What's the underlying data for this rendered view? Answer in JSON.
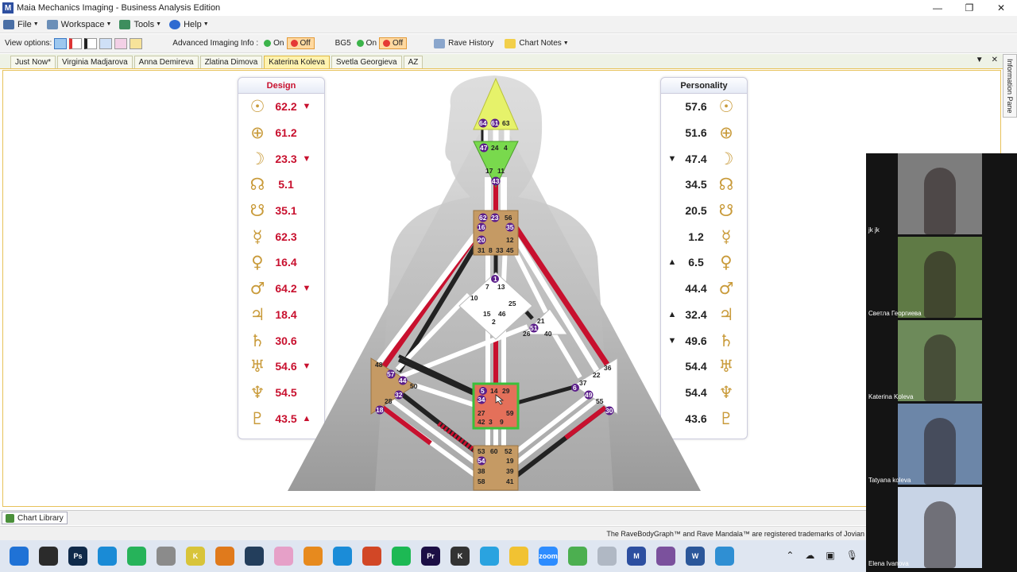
{
  "window": {
    "title": "Maia Mechanics Imaging - Business Analysis Edition"
  },
  "menu": [
    {
      "label": "File",
      "color": "#4a6fa5"
    },
    {
      "label": "Workspace",
      "color": "#6b8fb8"
    },
    {
      "label": "Tools",
      "color": "#3e8e5e"
    },
    {
      "label": "Help",
      "color": "#2f6bd1"
    }
  ],
  "toolbar": {
    "view_options_label": "View options:",
    "advanced_label": "Advanced Imaging Info :",
    "bg5_label": "BG5",
    "on_label": "On",
    "off_label": "Off",
    "rave_history": "Rave History",
    "chart_notes": "Chart Notes"
  },
  "tabs": [
    {
      "label": "Just Now*",
      "active": false
    },
    {
      "label": "Virginia Madjarova",
      "active": false
    },
    {
      "label": "Anna Demireva",
      "active": false
    },
    {
      "label": "Zlatina Dimova",
      "active": false
    },
    {
      "label": "Katerina Koleva",
      "active": true
    },
    {
      "label": "Svetla Georgieva",
      "active": false
    },
    {
      "label": "AZ",
      "active": false
    }
  ],
  "info_pane_label": "Information Pane",
  "design": {
    "title": "Design",
    "rows": [
      {
        "glyph": "☉",
        "value": "62.2",
        "arrow": "▼"
      },
      {
        "glyph": "⊕",
        "value": "61.2",
        "arrow": ""
      },
      {
        "glyph": "☽",
        "value": "23.3",
        "arrow": "▼"
      },
      {
        "glyph": "☊",
        "value": "5.1",
        "arrow": ""
      },
      {
        "glyph": "☋",
        "value": "35.1",
        "arrow": ""
      },
      {
        "glyph": "☿",
        "value": "62.3",
        "arrow": ""
      },
      {
        "glyph": "♀",
        "value": "16.4",
        "arrow": ""
      },
      {
        "glyph": "♂",
        "value": "64.2",
        "arrow": "▼"
      },
      {
        "glyph": "♃",
        "value": "18.4",
        "arrow": ""
      },
      {
        "glyph": "♄",
        "value": "30.6",
        "arrow": ""
      },
      {
        "glyph": "♅",
        "value": "54.6",
        "arrow": "▼"
      },
      {
        "glyph": "♆",
        "value": "54.5",
        "arrow": ""
      },
      {
        "glyph": "♇",
        "value": "43.5",
        "arrow": "▲"
      }
    ]
  },
  "personality": {
    "title": "Personality",
    "rows": [
      {
        "glyph": "☉",
        "value": "57.6",
        "arrow": ""
      },
      {
        "glyph": "⊕",
        "value": "51.6",
        "arrow": ""
      },
      {
        "glyph": "☽",
        "value": "47.4",
        "arrow": "▼"
      },
      {
        "glyph": "☊",
        "value": "34.5",
        "arrow": ""
      },
      {
        "glyph": "☋",
        "value": "20.5",
        "arrow": ""
      },
      {
        "glyph": "☿",
        "value": "1.2",
        "arrow": ""
      },
      {
        "glyph": "♀",
        "value": "6.5",
        "arrow": "▲"
      },
      {
        "glyph": "♂",
        "value": "44.4",
        "arrow": ""
      },
      {
        "glyph": "♃",
        "value": "32.4",
        "arrow": "▲"
      },
      {
        "glyph": "♄",
        "value": "49.6",
        "arrow": "▼"
      },
      {
        "glyph": "♅",
        "value": "54.4",
        "arrow": ""
      },
      {
        "glyph": "♆",
        "value": "54.4",
        "arrow": ""
      },
      {
        "glyph": "♇",
        "value": "43.6",
        "arrow": ""
      }
    ]
  },
  "bodygraph": {
    "head_gates": [
      "64",
      "61",
      "63"
    ],
    "ajna_gates": [
      "47",
      "24",
      "4",
      "17",
      "11",
      "43"
    ],
    "throat_gates": [
      "62",
      "23",
      "56",
      "16",
      "35",
      "20",
      "12",
      "31",
      "8",
      "33",
      "45"
    ],
    "g_gates": [
      "1",
      "7",
      "13",
      "10",
      "25",
      "15",
      "46",
      "2"
    ],
    "ego_gates": [
      "21",
      "51",
      "26",
      "40"
    ],
    "spleen_gates": [
      "48",
      "57",
      "44",
      "50",
      "32",
      "28",
      "18"
    ],
    "sacral_gates": [
      "5",
      "14",
      "29",
      "34",
      "27",
      "59",
      "42",
      "3",
      "9"
    ],
    "solar_gates": [
      "36",
      "22",
      "37",
      "6",
      "49",
      "55",
      "30"
    ],
    "root_gates": [
      "53",
      "60",
      "52",
      "54",
      "19",
      "38",
      "39",
      "58",
      "41"
    ]
  },
  "chart_library": "Chart Library",
  "trademark": "The RaveBodyGraph™ and Rave Mandala™ are registered trademarks of Jovian",
  "participants": [
    {
      "name": "jk jk",
      "bg": "#7d7d7d"
    },
    {
      "name": "Светла Георгиева",
      "bg": "#5f7a45"
    },
    {
      "name": "Katerina Koleva",
      "bg": "#6d8a5a"
    },
    {
      "name": "Tatyana koleva",
      "bg": "#6c86a8"
    },
    {
      "name": "Elena Ivanova",
      "bg": "#c8d4e6"
    }
  ],
  "taskbar_apps": [
    {
      "name": "start",
      "label": "",
      "color": "#1f72d6"
    },
    {
      "name": "terminal",
      "label": "",
      "color": "#2b2b2b"
    },
    {
      "name": "photoshop",
      "label": "Ps",
      "color": "#0f2a4a"
    },
    {
      "name": "edge",
      "label": "",
      "color": "#1a8bd6"
    },
    {
      "name": "whatsapp",
      "label": "",
      "color": "#26b35a"
    },
    {
      "name": "mic-app",
      "label": "",
      "color": "#8b8b8b"
    },
    {
      "name": "killer",
      "label": "K",
      "color": "#d8c43a"
    },
    {
      "name": "search-app",
      "label": "",
      "color": "#e07a1c"
    },
    {
      "name": "vpn",
      "label": "",
      "color": "#233e5c"
    },
    {
      "name": "itunes",
      "label": "",
      "color": "#e6a0c8"
    },
    {
      "name": "vlc",
      "label": "",
      "color": "#e78a1e"
    },
    {
      "name": "snip",
      "label": "",
      "color": "#1b8cd8"
    },
    {
      "name": "powerpoint",
      "label": "",
      "color": "#d24726"
    },
    {
      "name": "spotify",
      "label": "",
      "color": "#1db954"
    },
    {
      "name": "premiere",
      "label": "Pr",
      "color": "#1c0f45"
    },
    {
      "name": "k-app",
      "label": "K",
      "color": "#333333"
    },
    {
      "name": "telegram",
      "label": "",
      "color": "#2aa3e0"
    },
    {
      "name": "folder",
      "label": "",
      "color": "#f1c232"
    },
    {
      "name": "zoom",
      "label": "zoom",
      "color": "#2d8cff"
    },
    {
      "name": "chrome",
      "label": "",
      "color": "#4caf50"
    },
    {
      "name": "clock",
      "label": "",
      "color": "#b0b8c4"
    },
    {
      "name": "maia",
      "label": "M",
      "color": "#2d4fa0"
    },
    {
      "name": "viber",
      "label": "",
      "color": "#7b519d"
    },
    {
      "name": "word",
      "label": "W",
      "color": "#2b579a"
    },
    {
      "name": "app-blue",
      "label": "",
      "color": "#2f8fd3"
    }
  ]
}
